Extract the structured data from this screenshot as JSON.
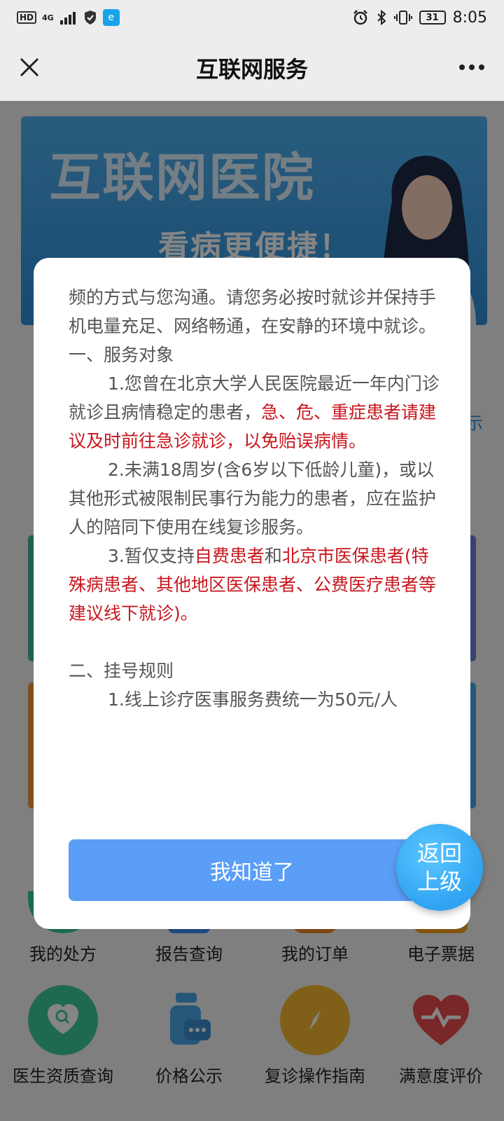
{
  "status_bar": {
    "left_badges": [
      "HD",
      "4G"
    ],
    "time": "8:05",
    "battery": "31"
  },
  "title_bar": {
    "title": "互联网服务",
    "more": "•••"
  },
  "banner": {
    "title": "互联网医院",
    "subtitle": "看病更便捷！"
  },
  "background": {
    "peek_text": "示"
  },
  "grid": {
    "row1": [
      {
        "label": "我的处方",
        "icon": "prescription-icon",
        "color": "#35c7a0"
      },
      {
        "label": "报告查询",
        "icon": "report-icon",
        "color": "#3a8cf0"
      },
      {
        "label": "我的订单",
        "icon": "order-icon",
        "color": "#f08a24"
      },
      {
        "label": "电子票据",
        "icon": "receipt-icon",
        "color": "#f5a623"
      }
    ],
    "row2": [
      {
        "label": "医生资质查询",
        "icon": "doctor-search-icon",
        "color": "#3ccaa0"
      },
      {
        "label": "价格公示",
        "icon": "price-icon",
        "color": "#4aa8e8"
      },
      {
        "label": "复诊操作指南",
        "icon": "compass-icon",
        "color": "#f5b82e"
      },
      {
        "label": "满意度评价",
        "icon": "heart-icon",
        "color": "#e84c4c"
      }
    ]
  },
  "modal": {
    "intro": "频的方式与您沟通。请您务必按时就诊并保持手机电量充足、网络畅通，在安静的环境中就诊。",
    "section1_title": "一、服务对象",
    "item1_normal": "1.您曾在北京大学人民医院最近一年内门诊就诊且病情稳定的患者，",
    "item1_red": "急、危、重症患者请建议及时前往急诊就诊，以免贻误病情。",
    "item2": "2.未满18周岁(含6岁以下低龄儿童)，或以其他形式被限制民事行为能力的患者，应在监护人的陪同下使用在线复诊服务。",
    "item3_prefix": "3.暂仅支持",
    "item3_red1": "自费患者",
    "item3_and": "和",
    "item3_red2": "北京市医保患者(特殊病患者、其他地区医保患者、公费医疗患者等建议线下就诊)。",
    "section2_title": "二、挂号规则",
    "item4": "1.线上诊疗医事服务费统一为50元/人",
    "confirm_label": "我知道了"
  },
  "back_fab": {
    "line1": "返回",
    "line2": "上级"
  },
  "colors": {
    "accent_blue": "#5a9ef7",
    "warning_red": "#c8161d",
    "fab_blue": "#2fa3f2"
  }
}
